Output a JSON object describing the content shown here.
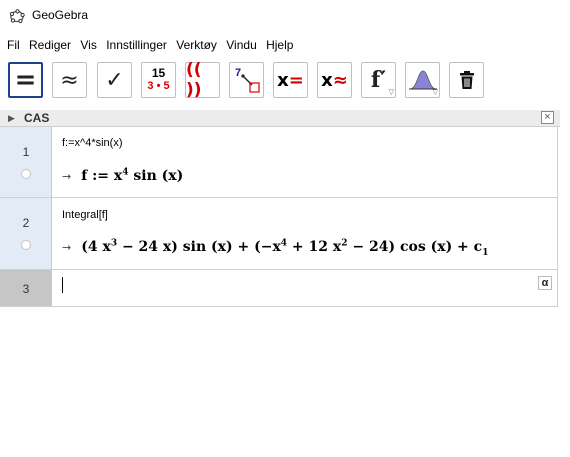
{
  "window": {
    "title": "GeoGebra"
  },
  "menu": [
    "Fil",
    "Rediger",
    "Vis",
    "Innstillinger",
    "Verktøy",
    "Vindu",
    "Hjelp"
  ],
  "toolbar": {
    "tools": [
      {
        "name": "evaluate-tool",
        "glyph": "="
      },
      {
        "name": "numeric-tool",
        "glyph": "≈"
      },
      {
        "name": "keep-input-tool",
        "glyph": "✓"
      },
      {
        "name": "factor-tool",
        "glyph": "15"
      },
      {
        "name": "expand-tool",
        "glyph": "(( ))"
      },
      {
        "name": "substitute-tool",
        "glyph": "7"
      },
      {
        "name": "solve-tool",
        "glyph": "x="
      },
      {
        "name": "solve-numerically-tool",
        "glyph": "x≈"
      },
      {
        "name": "derivative-tool",
        "glyph": "f′"
      },
      {
        "name": "probability-tool",
        "glyph": ""
      },
      {
        "name": "delete-tool",
        "glyph": ""
      }
    ],
    "factor_bottom": "3 • 5"
  },
  "cas": {
    "title": "CAS",
    "close": "×",
    "rows": [
      {
        "number": "1",
        "input": "f:=x^4*sin(x)",
        "output_html": "f := x<sup>4</sup> sin (x)"
      },
      {
        "number": "2",
        "input": "Integral[f]",
        "output_html": "(4 x<sup>3</sup> − 24 x) sin (x) + (−x<sup>4</sup> + 12 x<sup>2</sup> − 24) cos (x) + c<sub>1</sub>"
      },
      {
        "number": "3",
        "input": ""
      }
    ],
    "arrow": "→",
    "alpha_button": "α"
  }
}
